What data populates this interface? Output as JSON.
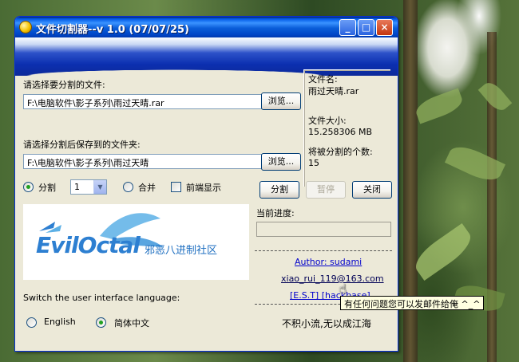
{
  "window": {
    "title": "文件切割器--v 1.0  (07/07/25)",
    "controls": {
      "minimize": "_",
      "maximize": "□",
      "close": "×"
    }
  },
  "source": {
    "label": "请选择要分割的文件:",
    "value": "F:\\电脑软件\\影子系列\\雨过天晴.rar",
    "browse_label": "浏览..."
  },
  "dest": {
    "label": "请选择分割后保存到的文件夹:",
    "value": "F:\\电脑软件\\影子系列\\雨过天晴",
    "browse_label": "浏览..."
  },
  "info": {
    "filename_label": "文件名:",
    "filename": "雨过天晴.rar",
    "size_label": "文件大小:",
    "size": "15.258306 MB",
    "count_label": "将被分割的个数:",
    "count": "15"
  },
  "mode": {
    "split_label": "分割",
    "split_selected": true,
    "split_value": "1",
    "merge_label": "合并",
    "topmost_label": "前端显示",
    "topmost_checked": false
  },
  "actions": {
    "split": "分割",
    "pause": "暂停",
    "close": "关闭"
  },
  "progress": {
    "label": "当前进度:",
    "value": 0
  },
  "credits": {
    "author": "Author: sudami",
    "email": "xiao_rui_119@163.com",
    "team": "[E.S.T] [hackbase]",
    "motto": "不积小流,无以成江海"
  },
  "tooltip": "有任何问题您可以发邮件给俺 ^_^",
  "language": {
    "label": "Switch the user interface language:",
    "english": "English",
    "chinese": "简体中文",
    "selected": "chinese"
  },
  "logo": {
    "text": "EvilOctal",
    "subtitle": "邪恶八进制社区"
  }
}
